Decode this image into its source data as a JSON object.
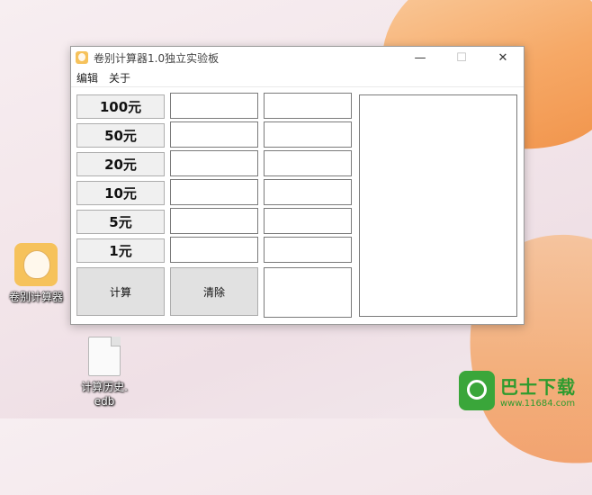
{
  "desktop": {
    "app_icon_label": "卷别计算器",
    "file_icon_label_line1": "计算历史.",
    "file_icon_label_line2": "edb"
  },
  "window": {
    "title": "卷别计算器1.0独立实验板",
    "controls": {
      "minimize": "—",
      "maximize": "☐",
      "close": "✕"
    },
    "menu": [
      "编辑",
      "关于"
    ],
    "denominations": [
      "100元",
      "50元",
      "20元",
      "10元",
      "5元",
      "1元"
    ],
    "calculate_label": "计算",
    "clear_label": "清除"
  },
  "watermark": {
    "title": "巴士下载",
    "url": "www.11684.com"
  },
  "colors": {
    "accent_orange": "#f6a55f",
    "button_face": "#f0f0f0",
    "watermark_green": "#2e9b2e"
  },
  "icons": [
    "app-icon",
    "file-icon",
    "minimize-icon",
    "maximize-icon",
    "close-icon"
  ]
}
